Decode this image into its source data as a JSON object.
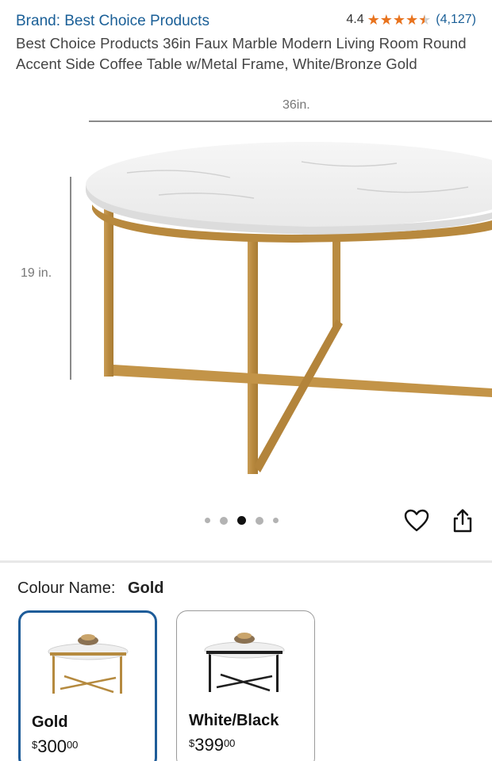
{
  "header": {
    "brand": "Brand: Best Choice Products",
    "rating": {
      "score": "4.4",
      "stars": 4.5,
      "count": "(4,127)"
    },
    "title": "Best Choice Products 36in Faux Marble Modern Living Room Round Accent Side Coffee Table w/Metal Frame, White/Bronze Gold"
  },
  "gallery": {
    "width_label": "36in.",
    "height_label": "19 in.",
    "image_count": 5,
    "active_index": 2
  },
  "actions": {
    "favorite_icon": "heart-icon",
    "share_icon": "share-icon"
  },
  "colour": {
    "label": "Colour Name:",
    "selected": "Gold",
    "options": [
      {
        "name": "Gold",
        "currency": "$",
        "whole": "300",
        "cents": "00",
        "frame_color": "#b58a3f",
        "selected": true
      },
      {
        "name": "White/Black",
        "currency": "$",
        "whole": "399",
        "cents": "00",
        "frame_color": "#1f1f1f",
        "selected": false
      }
    ]
  },
  "colors": {
    "link": "#1a5f97",
    "star": "#e8731e",
    "selected_border": "#1e5c99"
  }
}
